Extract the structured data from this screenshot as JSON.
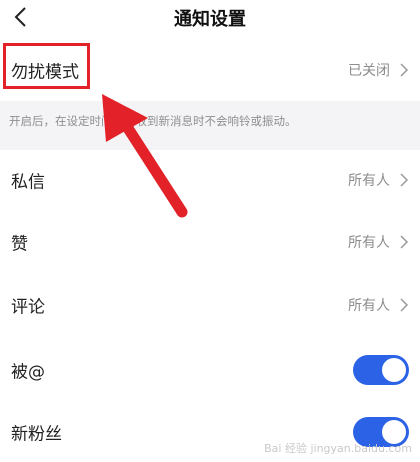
{
  "header": {
    "title": "通知设置"
  },
  "dnd": {
    "label": "勿扰模式",
    "value": "已关闭",
    "description": "开启后，在设定时间段内收到新消息时不会响铃或振动。"
  },
  "rows": [
    {
      "label": "私信",
      "value": "所有人"
    },
    {
      "label": "赞",
      "value": "所有人"
    },
    {
      "label": "评论",
      "value": "所有人"
    }
  ],
  "toggles": [
    {
      "label": "被@",
      "on": true
    },
    {
      "label": "新粉丝",
      "on": true
    }
  ],
  "watermark": "Bai 经验 jingyan.baidu.com",
  "colors": {
    "accent": "#2b62e6",
    "highlight": "#e22128"
  }
}
